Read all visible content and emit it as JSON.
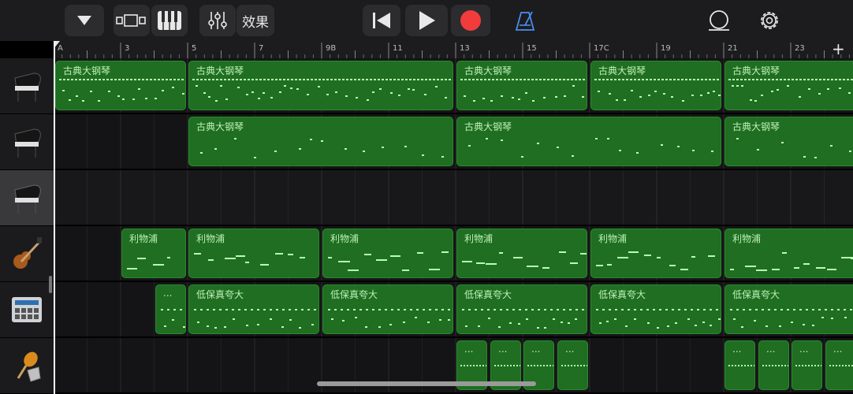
{
  "toolbar": {
    "effects_label": "效果",
    "icons": [
      "browser-dropdown-icon",
      "tracks-view-icon",
      "keyboard-icon",
      "mixer-icon",
      "rewind-icon",
      "play-icon",
      "record-icon",
      "metronome-icon",
      "loop-icon",
      "settings-icon"
    ],
    "colors": {
      "record": "#f23b3b",
      "metronome": "#4a8df0",
      "accent": "#e8e8e8"
    }
  },
  "ruler": {
    "markers": [
      "A",
      "3",
      "5",
      "7",
      "9B",
      "11",
      "13",
      "15",
      "17C",
      "19",
      "21",
      "23"
    ],
    "add_label": "+"
  },
  "tracks": [
    {
      "name": "grand-piano-1",
      "icon": "grand-piano-icon",
      "selected": false
    },
    {
      "name": "grand-piano-2",
      "icon": "grand-piano-icon",
      "selected": false
    },
    {
      "name": "grand-piano-3",
      "icon": "grand-piano-icon",
      "selected": true
    },
    {
      "name": "bass-guitar",
      "icon": "bass-guitar-icon",
      "selected": false
    },
    {
      "name": "drum-machine",
      "icon": "drum-machine-icon",
      "selected": false
    },
    {
      "name": "percussion",
      "icon": "maracas-icon",
      "selected": false
    }
  ],
  "regions": {
    "piano_label": "古典大钢琴",
    "bass_label": "利物浦",
    "beat_label": "低保真夸大",
    "short_label": "...",
    "colors": {
      "fill": "#1f6e22",
      "border": "#2b8a2e",
      "notes": "#b8ffb0"
    }
  }
}
